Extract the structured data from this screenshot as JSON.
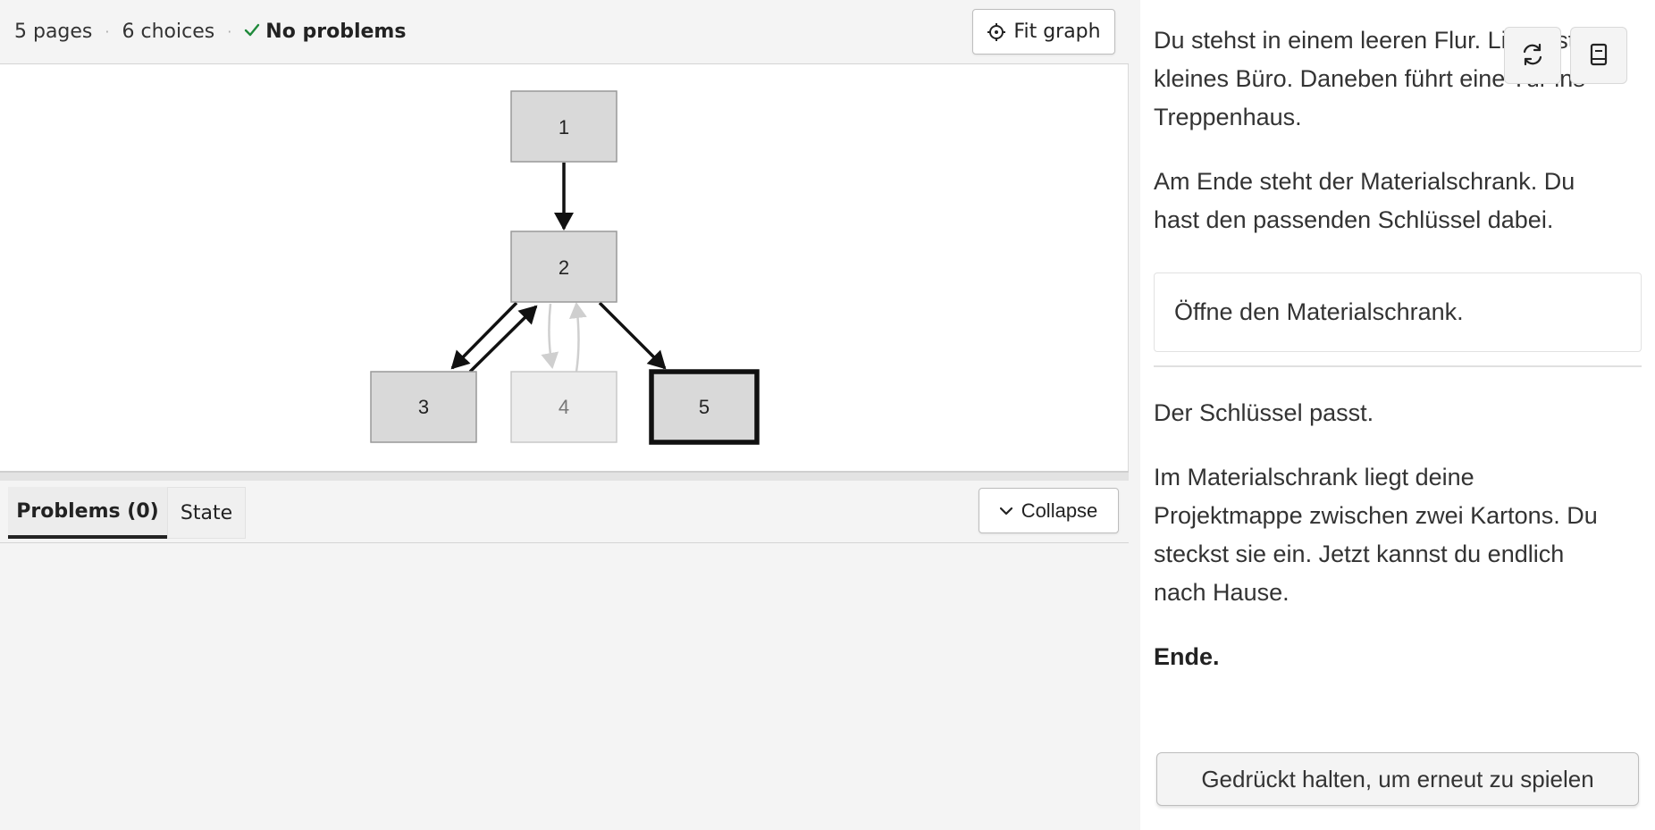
{
  "stats": {
    "pages": "5 pages",
    "choices": "6 choices",
    "separator": "·",
    "status_icon": "check-icon",
    "status_text": "No problems",
    "status_color": "#1f8a3b"
  },
  "toolbar": {
    "fit_graph_label": "Fit graph",
    "fit_graph_icon": "crosshair-icon"
  },
  "graph": {
    "nodes": [
      {
        "id": "1",
        "state": "visited"
      },
      {
        "id": "2",
        "state": "visited"
      },
      {
        "id": "3",
        "state": "visited"
      },
      {
        "id": "4",
        "state": "unvisited"
      },
      {
        "id": "5",
        "state": "current"
      }
    ],
    "edges": [
      {
        "from": "1",
        "to": "2",
        "visited": true
      },
      {
        "from": "2",
        "to": "3",
        "visited": true
      },
      {
        "from": "3",
        "to": "2",
        "visited": true
      },
      {
        "from": "2",
        "to": "4",
        "visited": false
      },
      {
        "from": "4",
        "to": "2",
        "visited": false
      },
      {
        "from": "2",
        "to": "5",
        "visited": true
      }
    ],
    "colors": {
      "visited_fill": "#d9d9d9",
      "visited_stroke": "#999999",
      "unvisited_fill": "#ececec",
      "unvisited_text": "#777777",
      "edge_visited": "#111111",
      "edge_unvisited": "#cccccc"
    }
  },
  "bottom_panel": {
    "tabs": [
      {
        "label": "Problems (0)",
        "active": true
      },
      {
        "label": "State",
        "active": false
      }
    ],
    "collapse_label": "Collapse",
    "collapse_icon": "chevron-down-icon"
  },
  "story": {
    "paragraph_1": "Du stehst in einem leeren Flur. Links ist ein kleines Büro. Daneben führt eine Tür ins Treppenhaus.",
    "paragraph_2": "Am Ende steht der Materialschrank. Du hast den passenden Schlüssel dabei.",
    "choice": "Öffne den Materialschrank.",
    "paragraph_3": "Der Schlüssel passt.",
    "paragraph_4": "Im Materialschrank liegt deine Projektmappe zwischen zwei Kartons. Du steckst sie ein. Jetzt kannst du endlich nach Hause.",
    "ending": "Ende.",
    "replay_label": "Gedrückt halten, um erneut zu spielen",
    "icons": [
      "refresh-icon",
      "book-icon"
    ]
  }
}
